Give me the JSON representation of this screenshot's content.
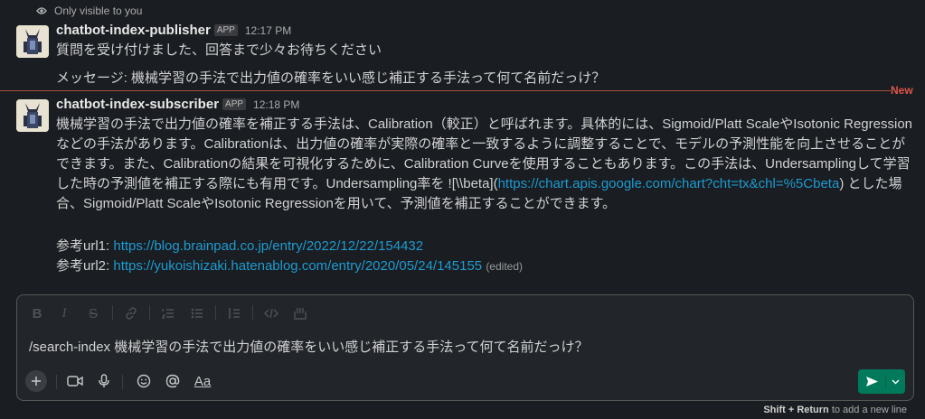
{
  "ephemeral_note": "Only visible to you",
  "messages": [
    {
      "sender": "chatbot-index-publisher",
      "badge": "APP",
      "time": "12:17 PM",
      "lines": [
        "質問を受け付けました、回答まで少々お待ちください",
        "メッセージ: 機械学習の手法で出力値の確率をいい感じ補正する手法って何て名前だっけ？"
      ]
    },
    {
      "sender": "chatbot-index-subscriber",
      "badge": "APP",
      "time": "12:18 PM",
      "lines": [
        "機械学習の手法で出力値の確率を補正する手法は、Calibration（較正）と呼ばれます。具体的には、Sigmoid/Platt ScaleやIsotonic Regression",
        "などの手法があります。Calibrationは、出力値の確率が実際の確率と一致するように調整することで、モデルの予測性能を向上させることが",
        "できます。また、Calibrationの結果を可視化するために、Calibration Curveを使用することもあります。この手法は、Undersamplingして学習",
        "した時の予測値を補正する際にも有用です。Undersampling率を ![\\\\beta](",
        "合、Sigmoid/Platt ScaleやIsotonic Regressionを用いて、予測値を補正することができます。"
      ],
      "inline_link": "https://chart.apis.google.com/chart?cht=tx&chl=%5Cbeta",
      "inline_link_suffix": ") とした場",
      "ref1_label": "参考url1: ",
      "ref1_url": "https://blog.brainpad.co.jp/entry/2022/12/22/154432",
      "ref2_label": "参考url2: ",
      "ref2_url": "https://yukoishizaki.hatenablog.com/entry/2020/05/24/145155",
      "edited": "(edited)"
    }
  ],
  "new_divider": "New",
  "composer": {
    "text": "/search-index 機械学習の手法で出力値の確率をいい感じ補正する手法って何て名前だっけ？",
    "toolbar": [
      "B",
      "I",
      "S"
    ],
    "format_label": "Aa",
    "hint_key": "Shift + Return",
    "hint_text": " to add a new line"
  },
  "colors": {
    "background": "#1a1d21",
    "link": "#1d9bd1",
    "new_divider": "#e0554a",
    "send_button": "#007a5a"
  }
}
